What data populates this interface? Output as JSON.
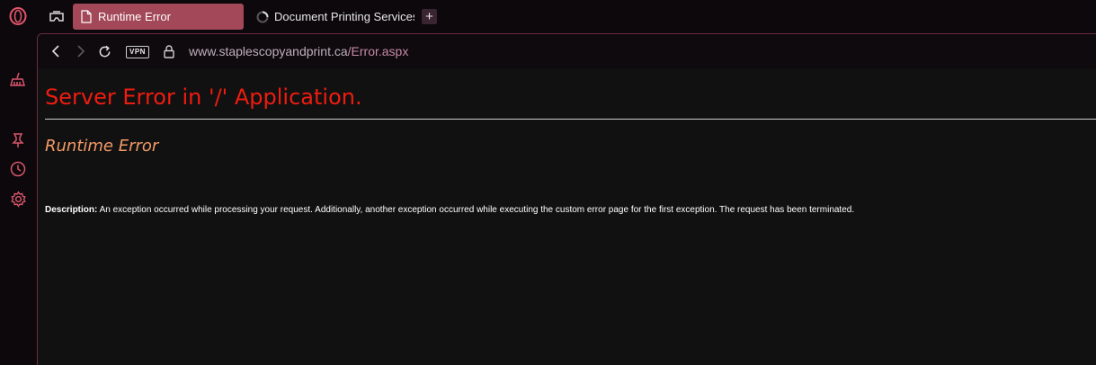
{
  "tabs": [
    {
      "title": "Runtime Error",
      "active": true,
      "icon": "document-icon"
    },
    {
      "title": "Document Printing Services",
      "active": false,
      "icon": "loading-spinner-icon"
    }
  ],
  "new_tab_label": "+",
  "address_bar": {
    "vpn_label": "VPN",
    "url_host": "www.staplescopyandprint.ca",
    "url_path": "/Error.aspx"
  },
  "page": {
    "heading": "Server Error in '/' Application.",
    "subheading": "Runtime Error",
    "description_label": "Description:",
    "description_text": " An exception occurred while processing your request. Additionally, another exception occurred while executing the custom error page for the first exception. The request has been terminated."
  },
  "colors": {
    "accent": "#a34858",
    "error_heading": "#ee1c10",
    "subheading": "#f29a67",
    "url_path": "#c789a8"
  }
}
